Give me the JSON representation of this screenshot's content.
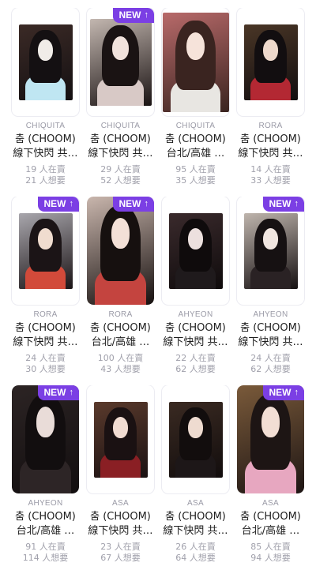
{
  "new_badge_label": "NEW",
  "cards": [
    {
      "member": "CHIQUITA",
      "title": "춤 (CHOOM)",
      "subtitle": "線下快閃 共…",
      "selling": "19 人在賣",
      "wanting": "21 人想要",
      "is_new": false,
      "tone": [
        "#3b2a26",
        "#141012",
        "#f0ece8",
        "#bfe6f2"
      ]
    },
    {
      "member": "CHIQUITA",
      "title": "춤 (CHOOM)",
      "subtitle": "線下快閃 共…",
      "selling": "29 人在賣",
      "wanting": "52 人想要",
      "is_new": true,
      "tone": [
        "#c3b7b0",
        "#1a1313",
        "#f1e2dc",
        "#d8c9c6"
      ]
    },
    {
      "member": "CHIQUITA",
      "title": "춤 (CHOOM)",
      "subtitle": "台北/高雄 …",
      "selling": "95 人在賣",
      "wanting": "35 人想要",
      "is_new": false,
      "tone": [
        "#b86a6a",
        "#3a2420",
        "#f6e3da",
        "#e8e6e2"
      ]
    },
    {
      "member": "RORA",
      "title": "춤 (CHOOM)",
      "subtitle": "線下快閃 共…",
      "selling": "14 人在賣",
      "wanting": "33 人想要",
      "is_new": false,
      "tone": [
        "#4a3626",
        "#120e10",
        "#eed9cc",
        "#b32833"
      ]
    },
    {
      "member": "RORA",
      "title": "춤 (CHOOM)",
      "subtitle": "線下快閃 共…",
      "selling": "24 人在賣",
      "wanting": "30 人想要",
      "is_new": true,
      "tone": [
        "#a9a7ad",
        "#1b1416",
        "#f0dccf",
        "#d24a3a"
      ]
    },
    {
      "member": "RORA",
      "title": "춤 (CHOOM)",
      "subtitle": "台北/高雄 …",
      "selling": "100 人在賣",
      "wanting": "43 人想要",
      "is_new": true,
      "tone": [
        "#c9b6ad",
        "#16100f",
        "#f3e0d7",
        "#c4443f"
      ]
    },
    {
      "member": "AHYEON",
      "title": "춤 (CHOOM)",
      "subtitle": "線下快閃 共…",
      "selling": "22 人在賣",
      "wanting": "62 人想要",
      "is_new": false,
      "tone": [
        "#3a2a2c",
        "#0f0b0c",
        "#ece0de",
        "#1f1a1c"
      ]
    },
    {
      "member": "AHYEON",
      "title": "춤 (CHOOM)",
      "subtitle": "線下快閃 共…",
      "selling": "24 人在賣",
      "wanting": "62 人想要",
      "is_new": true,
      "tone": [
        "#bfb5ad",
        "#161112",
        "#f1e6e0",
        "#2a2224"
      ]
    },
    {
      "member": "AHYEON",
      "title": "춤 (CHOOM)",
      "subtitle": "台北/高雄 …",
      "selling": "91 人在賣",
      "wanting": "114 人想要",
      "is_new": true,
      "tone": [
        "#2c2424",
        "#120e0f",
        "#e9dcd8",
        "#2d2526"
      ]
    },
    {
      "member": "ASA",
      "title": "춤 (CHOOM)",
      "subtitle": "線下快閃 共…",
      "selling": "23 人在賣",
      "wanting": "67 人想要",
      "is_new": false,
      "tone": [
        "#5a3a2c",
        "#1a1112",
        "#f1dcd2",
        "#8a1f24"
      ]
    },
    {
      "member": "ASA",
      "title": "춤 (CHOOM)",
      "subtitle": "線下快閃 共…",
      "selling": "26 人在賣",
      "wanting": "64 人想要",
      "is_new": false,
      "tone": [
        "#3a2a22",
        "#120d0d",
        "#eedbd0",
        "#1d1718"
      ]
    },
    {
      "member": "ASA",
      "title": "춤 (CHOOM)",
      "subtitle": "台北/高雄 …",
      "selling": "85 人在賣",
      "wanting": "94 人想要",
      "is_new": true,
      "tone": [
        "#7a5a3a",
        "#1d1514",
        "#f2ded4",
        "#e7a7c0"
      ]
    }
  ]
}
